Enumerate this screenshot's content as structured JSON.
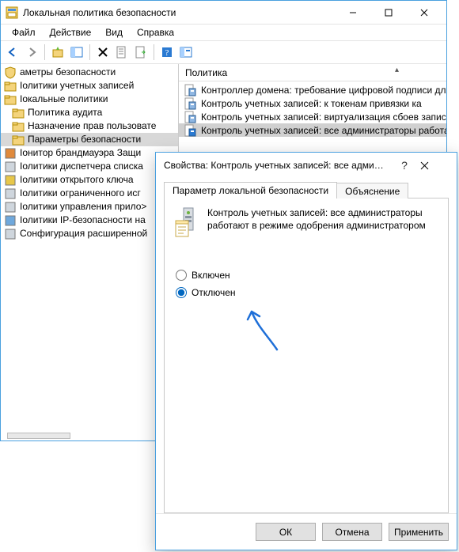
{
  "window": {
    "title": "Локальная политика безопасности",
    "menus": [
      "Файл",
      "Действие",
      "Вид",
      "Справка"
    ]
  },
  "tree": {
    "nodes": [
      {
        "label": "аметры безопасности",
        "indent": 0,
        "icon": "shield"
      },
      {
        "label": "Іолитики учетных записей",
        "indent": 0,
        "icon": "folder"
      },
      {
        "label": "Іокальные политики",
        "indent": 0,
        "icon": "folder"
      },
      {
        "label": "Политика аудита",
        "indent": 1,
        "icon": "folder"
      },
      {
        "label": "Назначение прав пользовате",
        "indent": 1,
        "icon": "folder"
      },
      {
        "label": "Параметры безопасности",
        "indent": 1,
        "icon": "folder",
        "selected": true
      },
      {
        "label": "Іонитор брандмауэра Защи",
        "indent": 0,
        "icon": "firewall"
      },
      {
        "label": "Іолитики диспетчера списка",
        "indent": 0,
        "icon": "list"
      },
      {
        "label": "Іолитики открытого ключа",
        "indent": 0,
        "icon": "key"
      },
      {
        "label": "Іолитики ограниченного исг",
        "indent": 0,
        "icon": "lock"
      },
      {
        "label": "Іолитики управления прило>",
        "indent": 0,
        "icon": "app"
      },
      {
        "label": "Іолитики IP-безопасности на",
        "indent": 0,
        "icon": "ipsec"
      },
      {
        "label": "Сонфигурация расширенной",
        "indent": 0,
        "icon": "adv"
      }
    ]
  },
  "list": {
    "header": "Политика",
    "rows": [
      {
        "label": "Контроллер домена: требование цифровой подписи для",
        "icon": "p1"
      },
      {
        "label": "Контроль учетных записей: к токенам привязки ка",
        "icon": "p1"
      },
      {
        "label": "Контроль учетных записей: виртуализация сбоев записи",
        "icon": "p1"
      },
      {
        "label": "Контроль учетных записей: все администраторы работа",
        "icon": "p2",
        "selected": true
      }
    ]
  },
  "dialog": {
    "title": "Свойства: Контроль учетных записей: все администрат...",
    "tabs": {
      "t1": "Параметр локальной безопасности",
      "t2": "Объяснение"
    },
    "policy_name": "Контроль учетных записей: все администраторы работают в режиме одобрения администратором",
    "radio_enabled": "Включен",
    "radio_disabled": "Отключен",
    "buttons": {
      "ok": "ОК",
      "cancel": "Отмена",
      "apply": "Применить"
    }
  }
}
